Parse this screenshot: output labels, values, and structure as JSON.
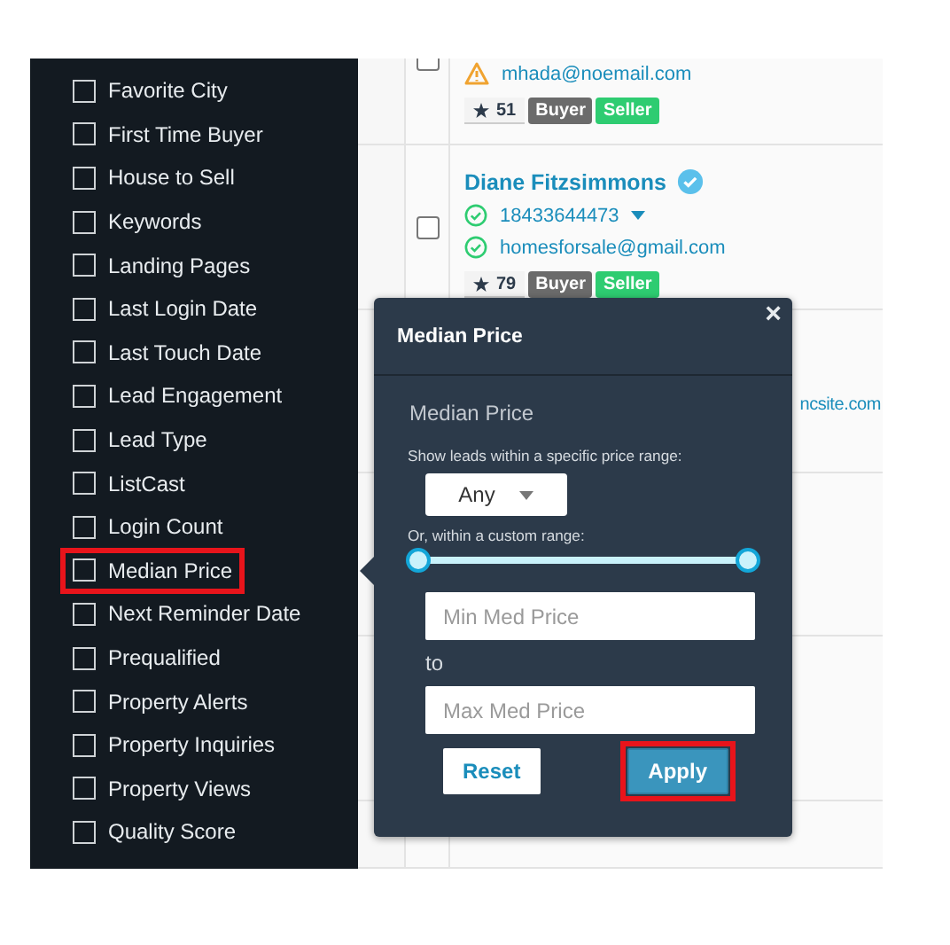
{
  "sidebar": {
    "items": [
      {
        "label": "Favorite City",
        "checked": false,
        "highlighted": false
      },
      {
        "label": "First Time Buyer",
        "checked": false,
        "highlighted": false
      },
      {
        "label": "House to Sell",
        "checked": false,
        "highlighted": false
      },
      {
        "label": "Keywords",
        "checked": false,
        "highlighted": false
      },
      {
        "label": "Landing Pages",
        "checked": false,
        "highlighted": false
      },
      {
        "label": "Last Login Date",
        "checked": false,
        "highlighted": false
      },
      {
        "label": "Last Touch Date",
        "checked": false,
        "highlighted": false
      },
      {
        "label": "Lead Engagement",
        "checked": false,
        "highlighted": false
      },
      {
        "label": "Lead Type",
        "checked": false,
        "highlighted": false
      },
      {
        "label": "ListCast",
        "checked": false,
        "highlighted": false
      },
      {
        "label": "Login Count",
        "checked": false,
        "highlighted": false
      },
      {
        "label": "Median Price",
        "checked": false,
        "highlighted": true
      },
      {
        "label": "Next Reminder Date",
        "checked": false,
        "highlighted": false
      },
      {
        "label": "Prequalified",
        "checked": false,
        "highlighted": false
      },
      {
        "label": "Property Alerts",
        "checked": false,
        "highlighted": false
      },
      {
        "label": "Property Inquiries",
        "checked": false,
        "highlighted": false
      },
      {
        "label": "Property Views",
        "checked": false,
        "highlighted": false
      },
      {
        "label": "Quality Score",
        "checked": false,
        "highlighted": false
      }
    ]
  },
  "leads": [
    {
      "checked": false,
      "contacts": [
        {
          "kind": "warning",
          "text": "mhada@noemail.com"
        }
      ],
      "score": "51",
      "tags": [
        {
          "label": "Buyer",
          "color": "#6b6b6b"
        },
        {
          "label": "Seller",
          "color": "#2ecc71"
        }
      ]
    },
    {
      "checked": false,
      "name": "Diane Fitzsimmons",
      "verified": true,
      "contacts": [
        {
          "kind": "phone",
          "text": "18433644473"
        },
        {
          "kind": "ok",
          "text": "homesforsale@gmail.com"
        }
      ],
      "score": "79",
      "tags": [
        {
          "label": "Buyer",
          "color": "#6b6b6b"
        },
        {
          "label": "Seller",
          "color": "#2ecc71"
        }
      ]
    },
    {
      "contacts": [
        {
          "kind": "hidden",
          "text": "ncsite.com"
        }
      ]
    }
  ],
  "popup": {
    "title": "Median Price",
    "close": "×",
    "section": "Median Price",
    "hint": "Show leads within a specific price range:",
    "select": "Any",
    "custom_label": "Or, within a custom range:",
    "slider": {
      "level": 1
    },
    "min": {
      "placeholder": "Min Med Price"
    },
    "to": "to",
    "max": {
      "placeholder": "Max Med Price"
    },
    "buttons": [
      {
        "label": "Reset",
        "kind": "secondary",
        "highlighted": false
      },
      {
        "label": "Apply",
        "kind": "primary",
        "highlighted": true
      }
    ]
  }
}
